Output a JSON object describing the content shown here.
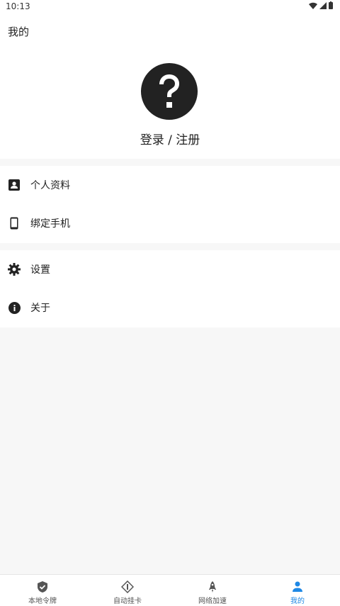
{
  "status_bar": {
    "time": "10:13"
  },
  "header": {
    "title": "我的",
    "login_label": "登录 / 注册"
  },
  "menu": {
    "group1": [
      {
        "label": "个人资料",
        "icon": "profile-card-icon"
      },
      {
        "label": "绑定手机",
        "icon": "phone-icon"
      }
    ],
    "group2": [
      {
        "label": "设置",
        "icon": "gear-icon"
      },
      {
        "label": "关于",
        "icon": "info-icon"
      }
    ]
  },
  "bottom_nav": {
    "active_color": "#1e88e5",
    "tabs": [
      {
        "label": "本地令牌",
        "icon": "shield-check-icon"
      },
      {
        "label": "自动挂卡",
        "icon": "diamond-icon"
      },
      {
        "label": "网络加速",
        "icon": "rocket-icon"
      },
      {
        "label": "我的",
        "icon": "person-icon",
        "active": true
      }
    ]
  }
}
